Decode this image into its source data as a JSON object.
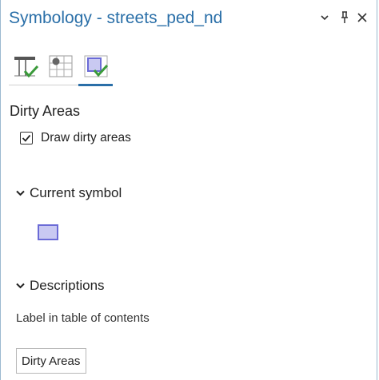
{
  "pane": {
    "title": "Symbology - streets_ped_nd",
    "controls": [
      "chevron-down-icon",
      "pin-icon",
      "close-icon"
    ]
  },
  "tabs": [
    {
      "icon": "table-check-icon",
      "active": false
    },
    {
      "icon": "grid-point-icon",
      "active": false
    },
    {
      "icon": "area-check-icon",
      "active": true
    }
  ],
  "dirty_areas": {
    "heading": "Dirty Areas",
    "checkbox_label": "Draw dirty areas",
    "checked": true
  },
  "current_symbol": {
    "header": "Current symbol",
    "fill_color": "#c9c9f2",
    "outline_color": "#6b6bd6"
  },
  "descriptions": {
    "header": "Descriptions",
    "label": "Label in table of contents",
    "value": "Dirty Areas"
  },
  "colors": {
    "accent": "#2a6fa8",
    "check_green": "#3a9a3a"
  }
}
